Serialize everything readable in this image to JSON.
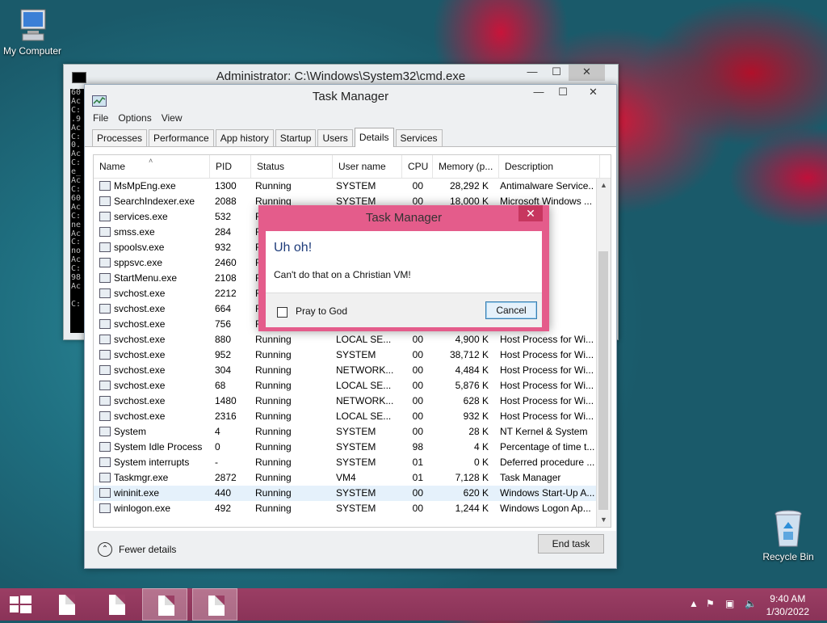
{
  "desktop": {
    "icons": [
      {
        "label": "My Computer"
      },
      {
        "label": "Recycle Bin"
      }
    ]
  },
  "cmd_window": {
    "title": "Administrator: C:\\Windows\\System32\\cmd.exe",
    "console_lines": "60\nAc\nC:\n.9\nAc\nC:\n0.\nAc\nC:\ne_\nAc\nC:\n60\nAc\nC:\nne\nAc\nC:\nno\nAc\nC:\n98\nAc\n\nC:"
  },
  "task_manager": {
    "title": "Task Manager",
    "menu": [
      "File",
      "Options",
      "View"
    ],
    "tabs": [
      "Processes",
      "Performance",
      "App history",
      "Startup",
      "Users",
      "Details",
      "Services"
    ],
    "active_tab": "Details",
    "columns": [
      "Name",
      "PID",
      "Status",
      "User name",
      "CPU",
      "Memory (p...",
      "Description"
    ],
    "rows": [
      {
        "name": "MsMpEng.exe",
        "pid": "1300",
        "status": "Running",
        "user": "SYSTEM",
        "cpu": "00",
        "mem": "28,292 K",
        "desc": "Antimalware Service..."
      },
      {
        "name": "SearchIndexer.exe",
        "pid": "2088",
        "status": "Running",
        "user": "SYSTEM",
        "cpu": "00",
        "mem": "18,000 K",
        "desc": "Microsoft Windows ..."
      },
      {
        "name": "services.exe",
        "pid": "532",
        "status": "R",
        "user": "",
        "cpu": "",
        "mem": "",
        "desc": "Control..."
      },
      {
        "name": "smss.exe",
        "pid": "284",
        "status": "R",
        "user": "",
        "cpu": "",
        "mem": "",
        "desc": "ion M..."
      },
      {
        "name": "spoolsv.exe",
        "pid": "932",
        "status": "R",
        "user": "",
        "cpu": "",
        "mem": "",
        "desc": "ystem ..."
      },
      {
        "name": "sppsvc.exe",
        "pid": "2460",
        "status": "R",
        "user": "",
        "cpu": "",
        "mem": "",
        "desc": "tware ..."
      },
      {
        "name": "StartMenu.exe",
        "pid": "2108",
        "status": "R",
        "user": "",
        "cpu": "",
        "mem": "",
        "desc": "enu"
      },
      {
        "name": "svchost.exe",
        "pid": "2212",
        "status": "R",
        "user": "",
        "cpu": "",
        "mem": "",
        "desc": "for Wi..."
      },
      {
        "name": "svchost.exe",
        "pid": "664",
        "status": "R",
        "user": "",
        "cpu": "",
        "mem": "",
        "desc": "for Wi..."
      },
      {
        "name": "svchost.exe",
        "pid": "756",
        "status": "R",
        "user": "",
        "cpu": "",
        "mem": "",
        "desc": "for Wi..."
      },
      {
        "name": "svchost.exe",
        "pid": "880",
        "status": "Running",
        "user": "LOCAL SE...",
        "cpu": "00",
        "mem": "4,900 K",
        "desc": "Host Process for Wi..."
      },
      {
        "name": "svchost.exe",
        "pid": "952",
        "status": "Running",
        "user": "SYSTEM",
        "cpu": "00",
        "mem": "38,712 K",
        "desc": "Host Process for Wi..."
      },
      {
        "name": "svchost.exe",
        "pid": "304",
        "status": "Running",
        "user": "NETWORK...",
        "cpu": "00",
        "mem": "4,484 K",
        "desc": "Host Process for Wi..."
      },
      {
        "name": "svchost.exe",
        "pid": "68",
        "status": "Running",
        "user": "LOCAL SE...",
        "cpu": "00",
        "mem": "5,876 K",
        "desc": "Host Process for Wi..."
      },
      {
        "name": "svchost.exe",
        "pid": "1480",
        "status": "Running",
        "user": "NETWORK...",
        "cpu": "00",
        "mem": "628 K",
        "desc": "Host Process for Wi..."
      },
      {
        "name": "svchost.exe",
        "pid": "2316",
        "status": "Running",
        "user": "LOCAL SE...",
        "cpu": "00",
        "mem": "932 K",
        "desc": "Host Process for Wi..."
      },
      {
        "name": "System",
        "pid": "4",
        "status": "Running",
        "user": "SYSTEM",
        "cpu": "00",
        "mem": "28 K",
        "desc": "NT Kernel & System"
      },
      {
        "name": "System Idle Process",
        "pid": "0",
        "status": "Running",
        "user": "SYSTEM",
        "cpu": "98",
        "mem": "4 K",
        "desc": "Percentage of time t..."
      },
      {
        "name": "System interrupts",
        "pid": "-",
        "status": "Running",
        "user": "SYSTEM",
        "cpu": "01",
        "mem": "0 K",
        "desc": "Deferred procedure ..."
      },
      {
        "name": "Taskmgr.exe",
        "pid": "2872",
        "status": "Running",
        "user": "VM4",
        "cpu": "01",
        "mem": "7,128 K",
        "desc": "Task Manager"
      },
      {
        "name": "wininit.exe",
        "pid": "440",
        "status": "Running",
        "user": "SYSTEM",
        "cpu": "00",
        "mem": "620 K",
        "desc": "Windows Start-Up A..."
      },
      {
        "name": "winlogon.exe",
        "pid": "492",
        "status": "Running",
        "user": "SYSTEM",
        "cpu": "00",
        "mem": "1,244 K",
        "desc": "Windows Logon Ap..."
      }
    ],
    "selected_row": "wininit.exe",
    "fewer_details": "Fewer details",
    "end_task": "End task"
  },
  "dialog": {
    "title": "Task Manager",
    "heading": "Uh oh!",
    "message": "Can't do that on a Christian VM!",
    "checkbox_label": "Pray to God",
    "cancel": "Cancel",
    "close_glyph": "✕"
  },
  "taskbar": {
    "time": "9:40 AM",
    "date": "1/30/2022"
  },
  "colors": {
    "dialog_frame": "#e45c8b",
    "taskbar": "#9b3e64"
  }
}
